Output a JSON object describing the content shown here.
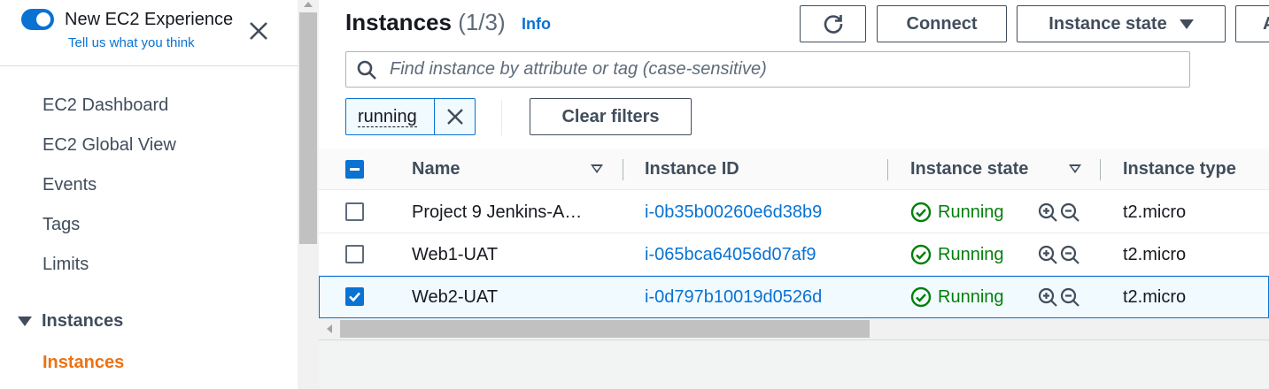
{
  "sidebar": {
    "experience_title": "New EC2 Experience",
    "experience_link": "Tell us what you think",
    "toggle_on": true,
    "items": [
      {
        "label": "EC2 Dashboard"
      },
      {
        "label": "EC2 Global View"
      },
      {
        "label": "Events"
      },
      {
        "label": "Tags"
      },
      {
        "label": "Limits"
      }
    ],
    "section": "Instances",
    "active_item": "Instances"
  },
  "header": {
    "title": "Instances",
    "count": "(1/3)",
    "info": "Info",
    "refresh_icon": "refresh-icon",
    "connect_label": "Connect",
    "instance_state_label": "Instance state",
    "actions_label_partial": "A"
  },
  "search": {
    "placeholder": "Find instance by attribute or tag (case-sensitive)"
  },
  "filters": {
    "token": "running",
    "clear_label": "Clear filters"
  },
  "table": {
    "columns": [
      "Name",
      "Instance ID",
      "Instance state",
      "Instance type"
    ],
    "rows": [
      {
        "name": "Project 9 Jenkins-A…",
        "id": "i-0b35b00260e6d38b9",
        "state": "Running",
        "type": "t2.micro",
        "selected": false
      },
      {
        "name": "Web1-UAT",
        "id": "i-065bca64056d07af9",
        "state": "Running",
        "type": "t2.micro",
        "selected": false
      },
      {
        "name": "Web2-UAT",
        "id": "i-0d797b10019d0526d",
        "state": "Running",
        "type": "t2.micro",
        "selected": true
      }
    ]
  },
  "colors": {
    "accent": "#0972d3",
    "active_nav": "#ec7211",
    "running": "#037f0c"
  }
}
